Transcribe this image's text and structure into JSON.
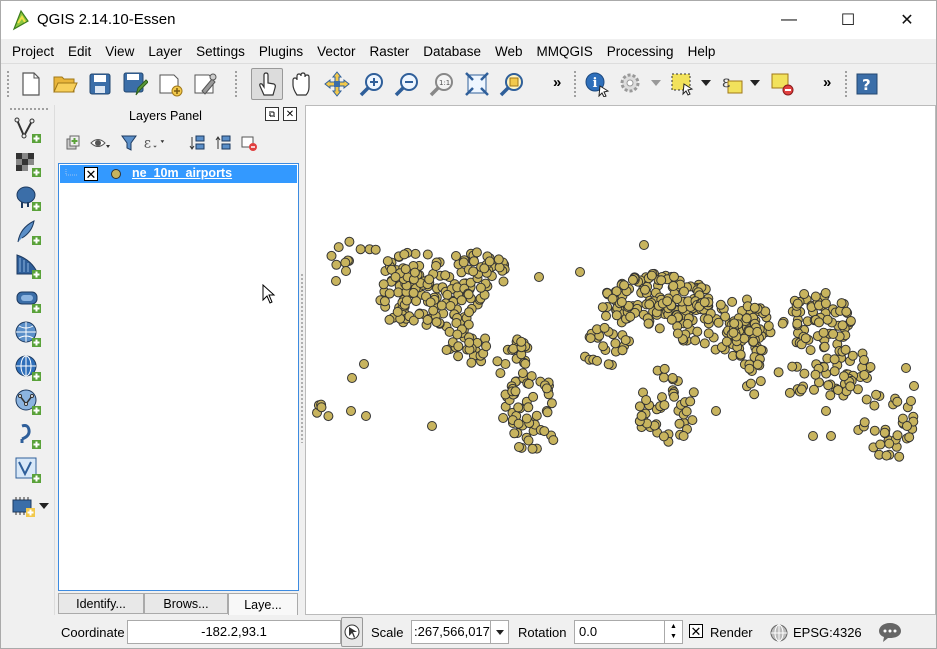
{
  "window": {
    "title": "QGIS 2.14.10-Essen",
    "minimize": "—",
    "maximize": "☐",
    "close": "✕"
  },
  "menu": [
    "Project",
    "Edit",
    "View",
    "Layer",
    "Settings",
    "Plugins",
    "Vector",
    "Raster",
    "Database",
    "Web",
    "MMQGIS",
    "Processing",
    "Help"
  ],
  "toolbar": {
    "more_label": "»",
    "buttons": [
      "new-project",
      "open-project",
      "save-project",
      "save-as",
      "new-print-composer",
      "composer-manager",
      "touch-zoom-pan",
      "pan-map",
      "pan-to-selection",
      "zoom-in",
      "zoom-out",
      "zoom-native",
      "zoom-full",
      "zoom-to-selection",
      "identify",
      "run-feature-action",
      "select-features",
      "select-by-expression",
      "deselect",
      "help"
    ]
  },
  "left_tools": [
    "add-vector-layer",
    "add-raster-layer",
    "add-postgis-layer",
    "add-spatialite-layer",
    "add-mssql-layer",
    "add-oracle-layer",
    "add-wms-layer",
    "add-wcs-layer",
    "add-wfs-layer",
    "add-delimited-text-layer",
    "add-virtual-layer",
    "new-shapefile-layer"
  ],
  "layers_panel": {
    "title": "Layers Panel",
    "float_label": "⧉",
    "close_label": "✕",
    "layers": [
      {
        "name": "ne_10m_airports",
        "visible_mark": "✕",
        "symbol_color": "#c8b45e"
      }
    ],
    "tabs": [
      "Identify...",
      "Brows...",
      "Laye..."
    ],
    "active_tab": "Laye..."
  },
  "map": {
    "point_fill": "#c8b45e",
    "point_stroke": "#333333",
    "background": "#ffffff"
  },
  "status": {
    "coordinate_label": "Coordinate",
    "coordinate_value": "-182.2,93.1",
    "scale_label": "Scale",
    "scale_value": ":267,566,017",
    "rotation_label": "Rotation",
    "rotation_value": "0.0",
    "render_label": "Render",
    "render_mark": "✕",
    "crs_label": "EPSG:4326"
  },
  "colors": {
    "selection": "#3399ff",
    "accent": "#3d8be0"
  }
}
